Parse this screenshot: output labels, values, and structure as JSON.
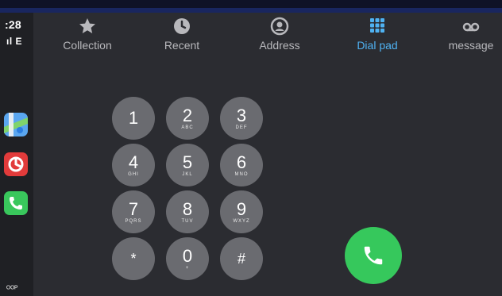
{
  "status": {
    "time": ":28",
    "network": "ıl E",
    "bottom_text": "ᴼᴼᴾ"
  },
  "tabs": [
    {
      "label": "Collection",
      "icon": "star-icon",
      "active": false
    },
    {
      "label": "Recent",
      "icon": "clock-icon",
      "active": false
    },
    {
      "label": "Address",
      "icon": "contact-icon",
      "active": false
    },
    {
      "label": "Dial pad",
      "icon": "keypad-icon",
      "active": true
    },
    {
      "label": "message",
      "icon": "voicemail-icon",
      "active": false
    }
  ],
  "keypad": [
    {
      "digit": "1",
      "letters": ""
    },
    {
      "digit": "2",
      "letters": "ABC"
    },
    {
      "digit": "3",
      "letters": "DEF"
    },
    {
      "digit": "4",
      "letters": "GHI"
    },
    {
      "digit": "5",
      "letters": "JKL"
    },
    {
      "digit": "6",
      "letters": "MNO"
    },
    {
      "digit": "7",
      "letters": "PQRS"
    },
    {
      "digit": "8",
      "letters": "TUV"
    },
    {
      "digit": "9",
      "letters": "WXYZ"
    },
    {
      "digit": "*",
      "letters": ""
    },
    {
      "digit": "0",
      "letters": "+"
    },
    {
      "digit": "#",
      "letters": ""
    }
  ],
  "colors": {
    "accent": "#4fb2f2",
    "call": "#36c85c",
    "key": "#6a6b70",
    "background": "#2b2c31"
  }
}
